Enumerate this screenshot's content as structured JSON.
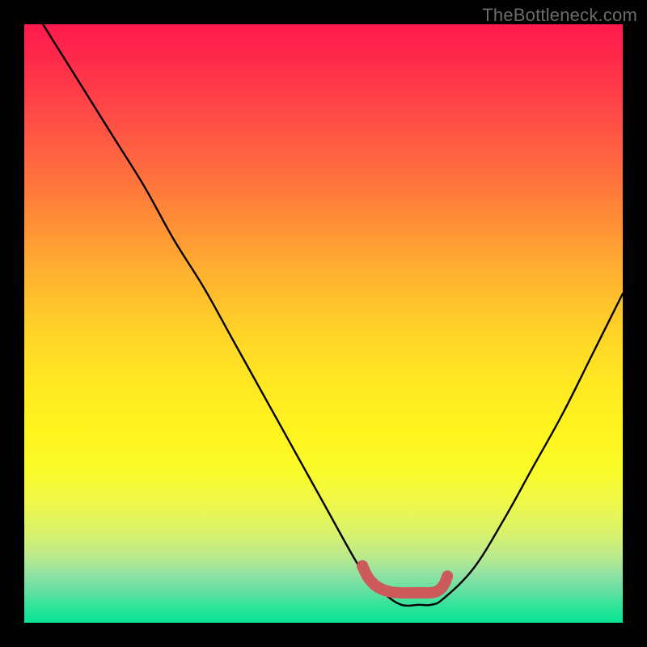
{
  "watermark": "TheBottleneck.com",
  "colors": {
    "background": "#000000",
    "curve_stroke": "#000000",
    "indicator_stroke": "#cc5a5a",
    "indicator_fill": "#cc5a5a",
    "gradient_top": "#ff1a4d",
    "gradient_bottom": "#0be493"
  },
  "chart_data": {
    "type": "line",
    "title": "",
    "xlabel": "",
    "ylabel": "",
    "xlim": [
      0,
      100
    ],
    "ylim": [
      0,
      100
    ],
    "series": [
      {
        "name": "bottleneck_curve",
        "x": [
          0,
          5,
          10,
          15,
          20,
          25,
          30,
          35,
          40,
          45,
          50,
          55,
          57,
          60,
          63,
          66,
          68,
          70,
          75,
          80,
          85,
          90,
          95,
          100
        ],
        "y": [
          105,
          97,
          89,
          81,
          73,
          64,
          56,
          47,
          38,
          29,
          20,
          11,
          8,
          5,
          3,
          3,
          3,
          4,
          9,
          17,
          26,
          35,
          45,
          55
        ]
      }
    ],
    "indicator": {
      "name": "optimal_range",
      "points": [
        {
          "x": 56.5,
          "y": 9.5
        },
        {
          "x": 57.5,
          "y": 7.5
        },
        {
          "x": 59.0,
          "y": 6.0
        },
        {
          "x": 61.0,
          "y": 5.2
        },
        {
          "x": 63.0,
          "y": 5.0
        },
        {
          "x": 65.0,
          "y": 5.0
        },
        {
          "x": 67.0,
          "y": 5.0
        },
        {
          "x": 68.5,
          "y": 5.1
        },
        {
          "x": 69.5,
          "y": 5.6
        },
        {
          "x": 70.2,
          "y": 6.5
        },
        {
          "x": 70.7,
          "y": 7.8
        }
      ]
    }
  }
}
